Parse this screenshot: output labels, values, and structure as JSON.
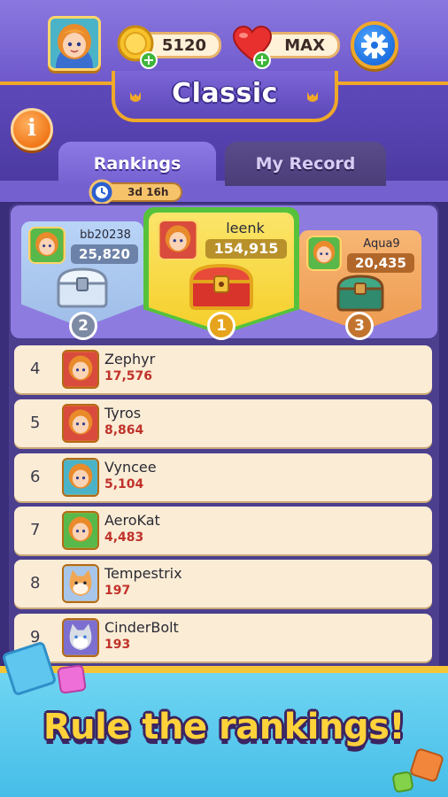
{
  "header": {
    "coins": "5120",
    "lives": "MAX",
    "mode_title": "Classic"
  },
  "tabs": [
    {
      "label": "Rankings",
      "active": true
    },
    {
      "label": "My Record",
      "active": false
    }
  ],
  "timer": "3d 16h",
  "podium": [
    {
      "rank": "1",
      "name": "leenk",
      "score": "154,915",
      "chest": "red-gold-chest-icon"
    },
    {
      "rank": "2",
      "name": "bb20238",
      "score": "25,820",
      "chest": "silver-chest-icon"
    },
    {
      "rank": "3",
      "name": "Aqua9",
      "score": "20,435",
      "chest": "green-chest-icon"
    }
  ],
  "rankings": [
    {
      "rank": "4",
      "name": "Zephyr",
      "score": "17,576",
      "avatar": "girl-avatar-icon"
    },
    {
      "rank": "5",
      "name": "Tyros",
      "score": "8,864",
      "avatar": "girl-avatar-icon"
    },
    {
      "rank": "6",
      "name": "Vyncee",
      "score": "5,104",
      "avatar": "girl-avatar-icon"
    },
    {
      "rank": "7",
      "name": "AeroKat",
      "score": "4,483",
      "avatar": "girl-avatar-icon"
    },
    {
      "rank": "8",
      "name": "Tempestrix",
      "score": "197",
      "avatar": "cat-avatar-icon"
    },
    {
      "rank": "9",
      "name": "CinderBolt",
      "score": "193",
      "avatar": "cat-avatar-icon"
    }
  ],
  "banner": {
    "text": "Rule the rankings!"
  },
  "colors": {
    "gold": "#f0a829",
    "purple": "#6b55c8",
    "score_red": "#c0322a",
    "banner_yellow": "#ffd23a"
  }
}
